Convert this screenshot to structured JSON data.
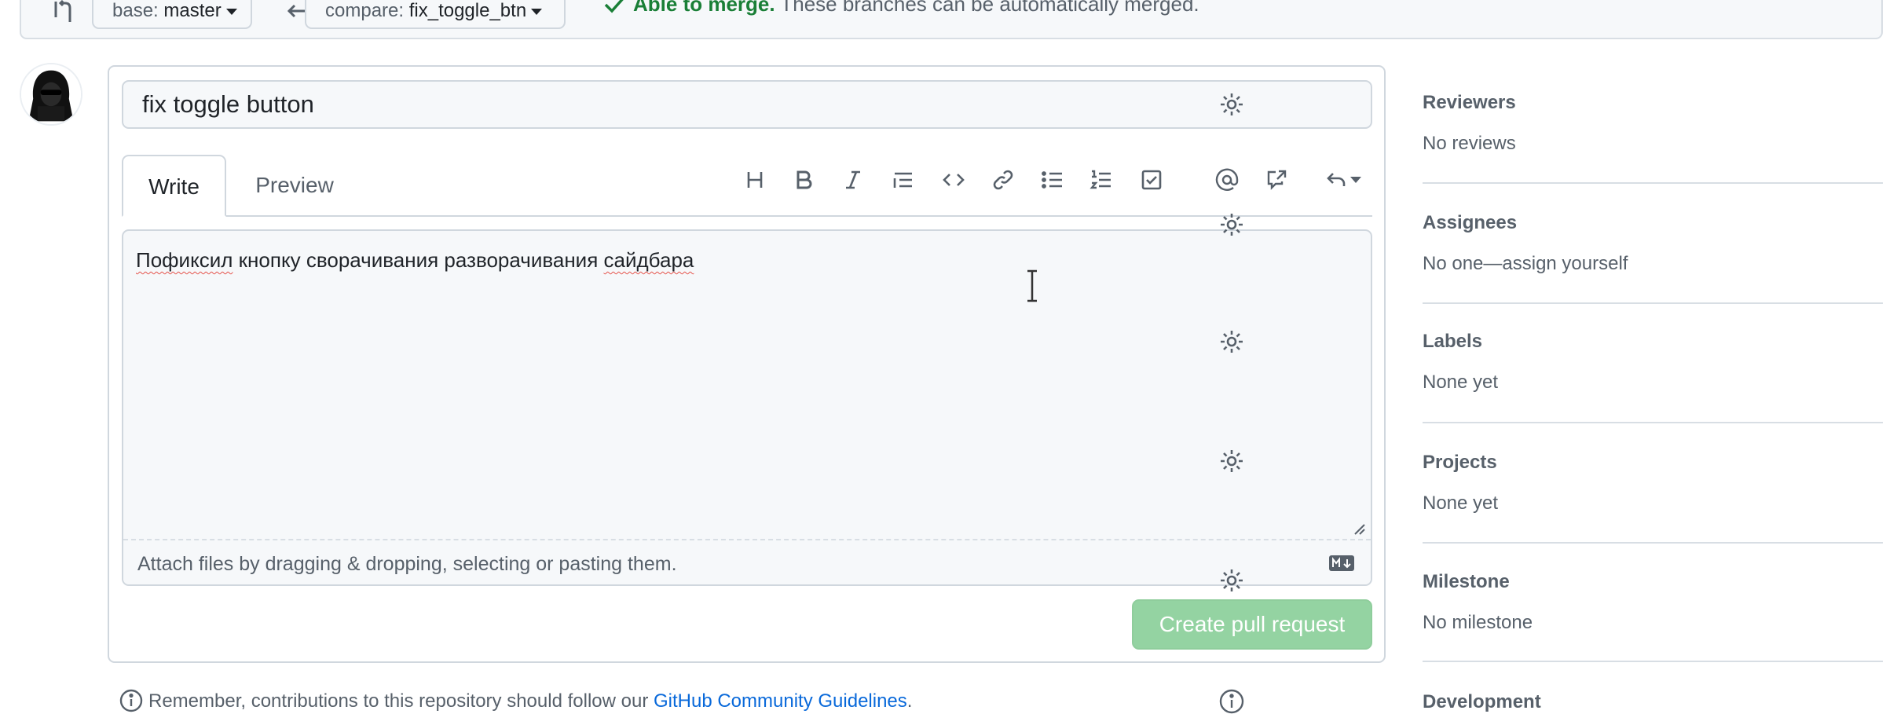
{
  "compare_bar": {
    "base_label": "base:",
    "base_value": "master",
    "compare_label": "compare:",
    "compare_value": "fix_toggle_btn",
    "merge_ok": "Able to merge.",
    "merge_detail": "These branches can be automatically merged."
  },
  "form": {
    "title_value": "fix toggle button",
    "tabs": [
      {
        "label": "Write",
        "active": true
      },
      {
        "label": "Preview",
        "active": false
      }
    ],
    "toolbar_icons": [
      "heading-icon",
      "bold-icon",
      "italic-icon",
      "quote-icon",
      "code-icon",
      "link-icon",
      "bulleted-list-icon",
      "numbered-list-icon",
      "task-list-icon",
      "mention-icon",
      "cross-reference-icon",
      "undo-icon"
    ],
    "body_word_1": "Пофиксил",
    "body_middle": "кнопку сворачивания разворачивания",
    "body_word_2": "сайдбара",
    "attach_text": "Attach files by dragging & dropping, selecting or pasting them.",
    "create_button": "Create pull request"
  },
  "guidelines": {
    "prefix": "Remember, contributions to this repository should follow our ",
    "link": "GitHub Community Guidelines",
    "suffix": "."
  },
  "sidebar": {
    "sections": [
      {
        "title": "Reviewers",
        "value": "No reviews"
      },
      {
        "title": "Assignees",
        "value": "No one—assign yourself"
      },
      {
        "title": "Labels",
        "value": "None yet"
      },
      {
        "title": "Projects",
        "value": "None yet"
      },
      {
        "title": "Milestone",
        "value": "No milestone"
      },
      {
        "title": "Development",
        "value": ""
      }
    ]
  },
  "colors": {
    "accent_green": "#1a7f37",
    "button_disabled_green": "#94d3a2",
    "link_blue": "#0969da"
  }
}
